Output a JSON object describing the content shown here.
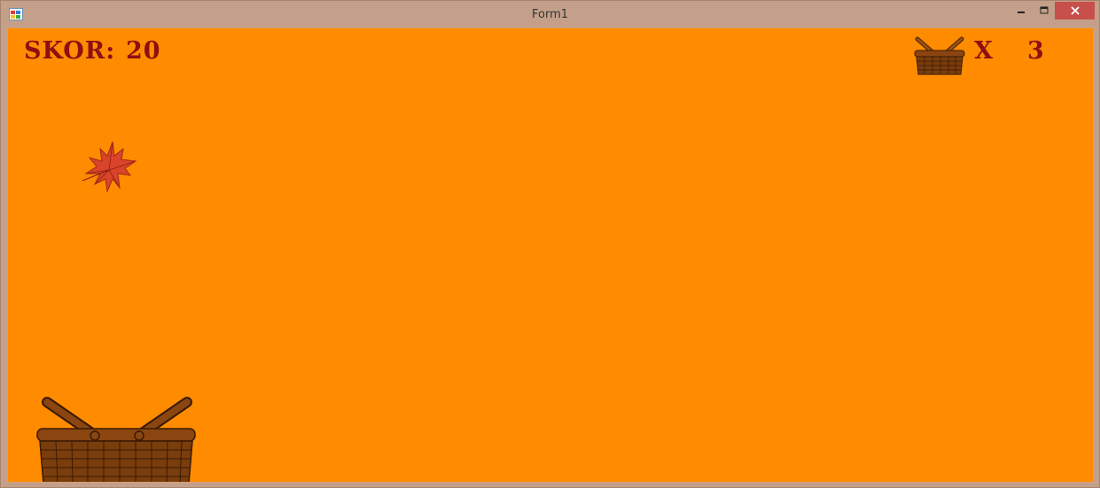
{
  "window": {
    "title": "Form1",
    "icons": {
      "app": "app-icon",
      "minimize": "minimize-icon",
      "maximize": "maximize-icon",
      "close": "close-icon"
    }
  },
  "hud": {
    "score_label": "SKOR:",
    "score_value": "20",
    "lives_multiplier": "X",
    "lives_value": "3",
    "lives_icon": "basket-icon"
  },
  "sprites": {
    "leaf": "maple-leaf",
    "player": "basket"
  },
  "colors": {
    "background": "#ff8c00",
    "hud_text": "#8e0f12",
    "window_frame": "#c4a08a",
    "close_button": "#c7504b",
    "basket": "#7a3d0c"
  }
}
